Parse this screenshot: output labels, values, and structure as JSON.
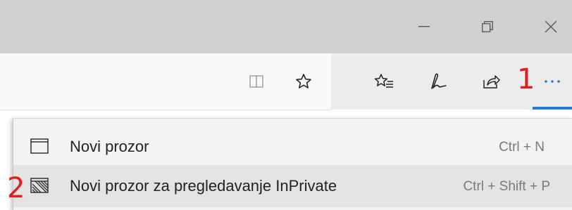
{
  "window_controls": {
    "minimize_icon": "minimize-icon",
    "restore_icon": "restore-icon",
    "close_icon": "close-icon"
  },
  "toolbar": {
    "icons": [
      "reading-view-icon",
      "favorite-star-icon",
      "favorites-hub-icon",
      "web-note-icon",
      "share-icon",
      "more-actions-icon"
    ],
    "accent_color": "#2a7ad5"
  },
  "annotations": {
    "step1": "1",
    "step2": "2",
    "color": "#e02020"
  },
  "menu": {
    "items": [
      {
        "label": "Novi prozor",
        "shortcut": "Ctrl + N",
        "icon": "window-icon"
      },
      {
        "label": "Novi prozor za pregledavanje InPrivate",
        "shortcut": "Ctrl + Shift + P",
        "icon": "inprivate-window-icon"
      }
    ]
  }
}
